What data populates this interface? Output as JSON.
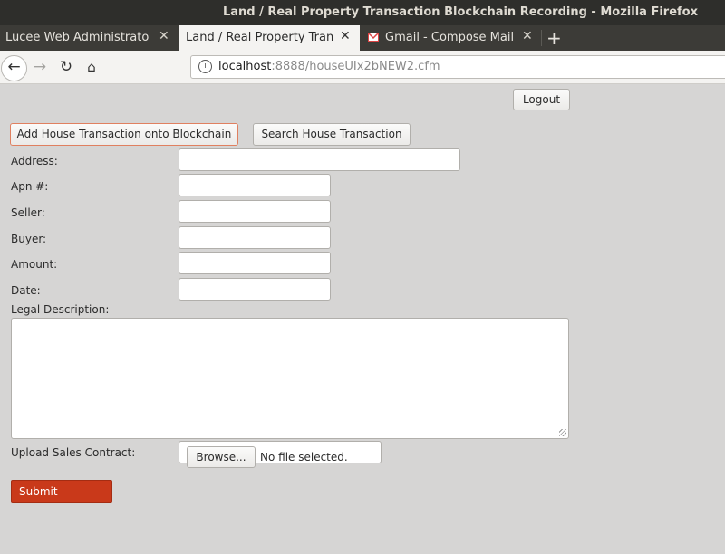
{
  "window": {
    "title": "Land / Real Property Transaction Blockchain Recording - Mozilla Firefox"
  },
  "tabs": [
    {
      "label": "Lucee Web Administrator"
    },
    {
      "label": "Land / Real Property Transaction Blockchain Recording"
    },
    {
      "label": "Gmail - Compose Mail"
    }
  ],
  "toolbar": {
    "back_icon": "←",
    "forward_icon": "→",
    "reload_icon": "↻",
    "home_icon": "⌂",
    "close_icon": "✕",
    "newtab_icon": "+",
    "info_icon": "i"
  },
  "address_bar": {
    "host": "localhost",
    "rest": ":8888/houseUIx2bNEW2.cfm"
  },
  "page": {
    "logout_label": "Logout",
    "add_tab_label": "Add House Transaction onto Blockchain",
    "search_tab_label": "Search House Transaction",
    "fields": {
      "address": {
        "label": "Address:",
        "value": ""
      },
      "apn": {
        "label": "Apn #:",
        "value": ""
      },
      "seller": {
        "label": "Seller:",
        "value": ""
      },
      "buyer": {
        "label": "Buyer:",
        "value": ""
      },
      "amount": {
        "label": "Amount:",
        "value": ""
      },
      "date": {
        "label": "Date:",
        "value": ""
      }
    },
    "legal_description_label": "Legal Description:",
    "upload_label": "Upload Sales Contract:",
    "browse_label": "Browse...",
    "no_file_label": "No file selected.",
    "submit_label": "Submit"
  },
  "colors": {
    "accent": "#c9391a",
    "background": "#d6d5d4",
    "titlebar": "#2e2e2b"
  }
}
